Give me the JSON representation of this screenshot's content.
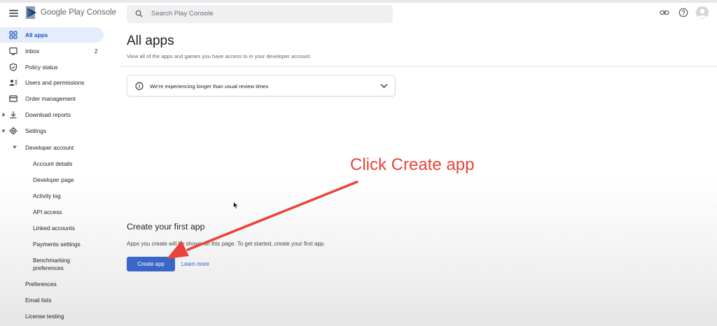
{
  "header": {
    "brand": "Google Play Console",
    "search_placeholder": "Search Play Console"
  },
  "sidebar": {
    "items": [
      {
        "label": "All apps",
        "icon": "grid-icon",
        "active": true
      },
      {
        "label": "Inbox",
        "icon": "inbox-icon",
        "badge": "2"
      },
      {
        "label": "Policy status",
        "icon": "shield-icon"
      },
      {
        "label": "Users and permissions",
        "icon": "users-icon"
      },
      {
        "label": "Order management",
        "icon": "card-icon"
      },
      {
        "label": "Download reports",
        "icon": "download-icon"
      },
      {
        "label": "Settings",
        "icon": "gear-icon"
      }
    ],
    "developer_account": "Developer account",
    "sub_items": [
      "Account details",
      "Developer page",
      "Activity log",
      "API access",
      "Linked accounts",
      "Payments settings"
    ],
    "benchmarking": [
      "Benchmarking",
      "preferences"
    ],
    "bottom_items": [
      "Preferences",
      "Email lists",
      "License testing"
    ]
  },
  "main": {
    "title": "All apps",
    "subtitle": "View all of the apps and games you have access to in your developer account",
    "notice": "We're experiencing longer than usual review times",
    "first_title": "Create your first app",
    "first_desc": "Apps you create will be shown on this page. To get started, create your first app.",
    "create_button": "Create app",
    "learn_more": "Learn more"
  },
  "annotation": {
    "text": "Click Create app",
    "color": "#e8443a"
  },
  "colors": {
    "accent": "#3a67c7",
    "active_bg": "#e5edfb"
  }
}
